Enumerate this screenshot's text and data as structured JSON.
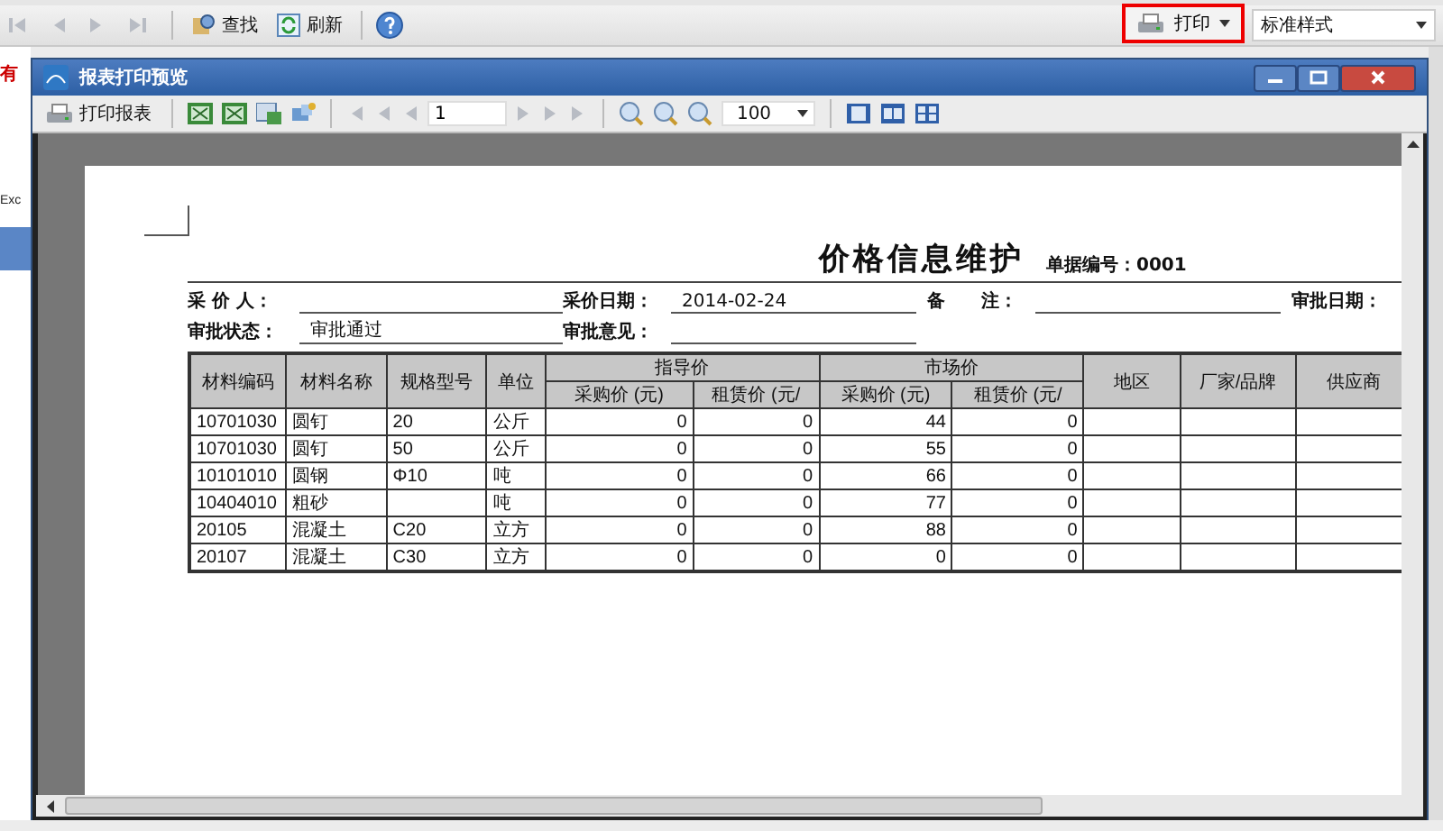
{
  "app_toolbar": {
    "buttons": [
      {
        "label": "查找"
      },
      {
        "label": "刷新"
      }
    ],
    "print_button": {
      "label": "打印"
    },
    "style_select": {
      "value": "标准样式"
    }
  },
  "background_fragments": [
    {
      "text": "有",
      "kind": "alert"
    },
    {
      "text": "Exc",
      "kind": "plain"
    }
  ],
  "dialog": {
    "title": "报表打印预览",
    "toolbar": {
      "print_report": "打印报表",
      "page": "1",
      "zoom": "100"
    },
    "report": {
      "title": "价格信息维护",
      "doc_no": "单据编号：0001",
      "field_rows": [
        [
          {
            "label": "采 价 人："
          },
          {
            "label": "采价日期：",
            "value": "2014-02-24"
          },
          {
            "label": "备　　注："
          },
          {
            "label": "审批日期："
          }
        ],
        [
          {
            "label": "审批状态：",
            "value": "审批通过"
          },
          {
            "label": "审批意见："
          }
        ]
      ],
      "table": {
        "header_rows": [
          [
            {
              "text": "材料编码",
              "rowspan": 2
            },
            {
              "text": "材料名称",
              "rowspan": 2
            },
            {
              "text": "规格型号",
              "rowspan": 2
            },
            {
              "text": "单位",
              "rowspan": 2
            },
            {
              "text": "指导价",
              "colspan": 2
            },
            {
              "text": "市场价",
              "colspan": 2
            },
            {
              "text": "地区",
              "rowspan": 2
            },
            {
              "text": "厂家/品牌",
              "rowspan": 2
            },
            {
              "text": "供应商",
              "rowspan": 2
            }
          ],
          [
            {
              "text": "采购价 (元)"
            },
            {
              "text": "租赁价 (元/"
            },
            {
              "text": "采购价 (元)"
            },
            {
              "text": "租赁价 (元/"
            }
          ]
        ],
        "rows": [
          [
            "10701030",
            "圆钉",
            "20",
            "公斤",
            "0",
            "0",
            "44",
            "0",
            "",
            "",
            ""
          ],
          [
            "10701030",
            "圆钉",
            "50",
            "公斤",
            "0",
            "0",
            "55",
            "0",
            "",
            "",
            ""
          ],
          [
            "10101010",
            "圆钢",
            "Φ10",
            "吨",
            "0",
            "0",
            "66",
            "0",
            "",
            "",
            ""
          ],
          [
            "10404010",
            "粗砂",
            "",
            "吨",
            "0",
            "0",
            "77",
            "0",
            "",
            "",
            ""
          ],
          [
            "20105",
            "混凝土",
            "C20",
            "立方",
            "0",
            "0",
            "88",
            "0",
            "",
            "",
            ""
          ],
          [
            "20107",
            "混凝土",
            "C30",
            "立方",
            "0",
            "0",
            "0",
            "0",
            "",
            "",
            ""
          ]
        ]
      }
    }
  }
}
